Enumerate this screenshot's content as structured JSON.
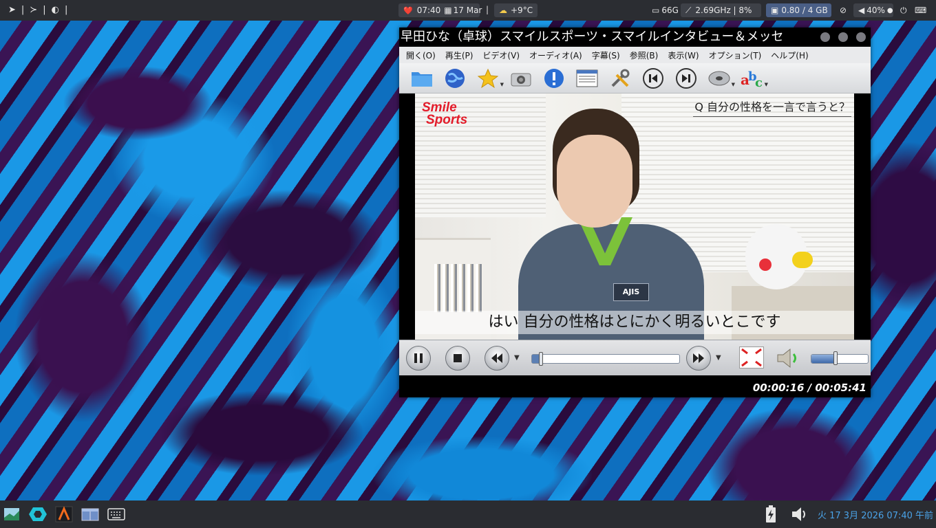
{
  "topbar": {
    "left_sep1": "|",
    "left_sep2": "|",
    "left_sep3": "|",
    "heart": "❤️",
    "time": "07:40",
    "date": "17 Mar",
    "divider": "|",
    "weather": "+9°C",
    "storage": "66G",
    "cpu": "2.69GHz | 8%",
    "load": "0.80 / 4 GB",
    "volume": "40%"
  },
  "player": {
    "title": "早田ひな（卓球）スマイルスポーツ・スマイルインタビュー＆メッセ",
    "menu": [
      "開く(O)",
      "再生(P)",
      "ビデオ(V)",
      "オーディオ(A)",
      "字幕(S)",
      "参照(B)",
      "表示(W)",
      "オプション(T)",
      "ヘルプ(H)"
    ],
    "video": {
      "logo_line1": "Smile",
      "logo_line2": "Sports",
      "question": "Q 自分の性格を一言で言うと？",
      "badge": "AJIS",
      "subtitle": "はい 自分の性格はとにかく明るいとこです"
    },
    "seek_fraction": 0.047,
    "volume_fraction": 0.4,
    "time_display": "00:00:16 / 00:05:41"
  },
  "bottombar": {
    "clock": "火 17  3月 2026 07:40 午前"
  },
  "colors": {
    "accent_clock": "#4aa3e8",
    "topbar_bg": "#2b2d32",
    "logo_red": "#e31c2a"
  }
}
